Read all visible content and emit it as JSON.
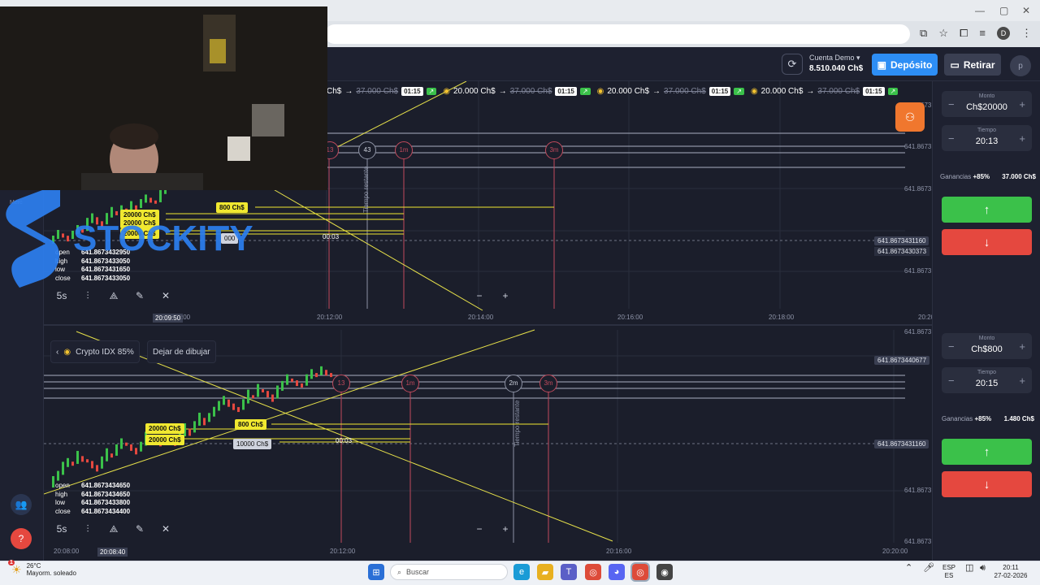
{
  "header": {
    "account_label": "Cuenta Demo",
    "balance": "8.510.040 Ch$",
    "deposit_label": "Depósito",
    "withdraw_label": "Retirar",
    "user_initial": "p",
    "browser_profile_initial": "D"
  },
  "trade_strip": [
    {
      "amount": "Ch$",
      "old": "37.000 Ch$",
      "time": "01:15"
    },
    {
      "amount": "20.000 Ch$",
      "old": "37.000 Ch$",
      "time": "01:15"
    },
    {
      "amount": "20.000 Ch$",
      "old": "37.000 Ch$",
      "time": "01:15"
    },
    {
      "amount": "20.000 Ch$",
      "old": "37.000 Ch$",
      "time": "01:15"
    }
  ],
  "panel_top": {
    "amount_label": "Monto",
    "amount": "Ch$20000",
    "time_label": "Tiempo",
    "time": "20:13",
    "gain_label": "Ganancias",
    "gain_pct": "+85%",
    "gain_amount": "37.000 Ch$"
  },
  "panel_bottom": {
    "amount_label": "Monto",
    "amount": "Ch$800",
    "time_label": "Tiempo",
    "time": "20:15",
    "gain_label": "Ganancias",
    "gain_pct": "+85%",
    "gain_amount": "1.480 Ch$"
  },
  "chart_top": {
    "price_labels": [
      "641.8673",
      "641.8673",
      "641.8673",
      "641.8673431160",
      "641.8673430373",
      "641.8673"
    ],
    "x_labels": [
      "20:09:50",
      ":00",
      "20:12:00",
      "20:14:00",
      "20:16:00",
      "20:18:00",
      "20:20"
    ],
    "timers": [
      "13",
      "43",
      "1m",
      "3m"
    ],
    "remaining_label": "Tiempo restante",
    "order_tags": [
      "800 Ch$",
      "20000 Ch$",
      "20000 Ch$",
      "20000 Ch$",
      "000"
    ],
    "countdown": "00:03",
    "ohlc": {
      "open": "641.8673432950",
      "high": "641.8673433050",
      "low": "641.8673431650",
      "close": "641.8673433050"
    },
    "tf": "5s"
  },
  "chart_bottom": {
    "price_labels": [
      "641.8673",
      "641.8673440677",
      "641.8673",
      "641.8673431160",
      "641.8673",
      "641.8673"
    ],
    "x_labels": [
      "20:08:00",
      "20:08:40",
      "20:12:00",
      "20:16:00",
      "20:20:00"
    ],
    "timers": [
      "13",
      "1m",
      "2m",
      "3m"
    ],
    "remaining_label": "Tiempo restante",
    "order_tags": [
      "800 Ch$",
      "20000 Ch$",
      "20000 Ch$",
      "10000 Ch$"
    ],
    "countdown": "00:03",
    "ohlc": {
      "open": "641.8673434650",
      "high": "641.8673434650",
      "low": "641.8673433800",
      "close": "641.8673434400"
    },
    "tf": "5s",
    "pair": "Crypto IDX 85%",
    "stop_drawing": "Dejar de dibujar"
  },
  "logo_text": "STOCKITY",
  "sidebar_label": "Merc",
  "taskbar": {
    "temp": "26°C",
    "weather": "Mayorm. soleado",
    "search": "Buscar",
    "lang1": "ESP",
    "lang2": "ES",
    "time": "20:11",
    "date": "27-02-2026",
    "badge": "1"
  }
}
